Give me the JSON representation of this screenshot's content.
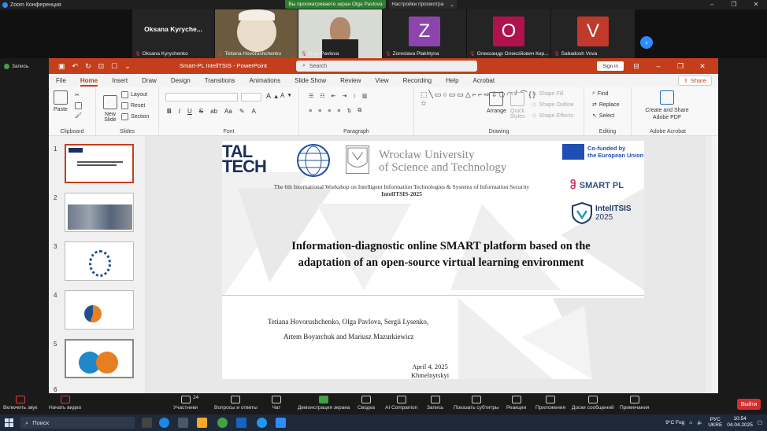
{
  "zoom": {
    "title": "Zoom Конференция",
    "share_notice": "Вы просматриваете экран Olga Pavlova",
    "view_options": "Настройки просмотра",
    "recording_label": "Запись",
    "participants": [
      {
        "name": "Oksana Kyrychenko",
        "big": "Oksana  Kyryche...",
        "type": "text"
      },
      {
        "name": "Tetiana Hovorushchenko",
        "type": "video"
      },
      {
        "name": "Olga Pavlova",
        "type": "video"
      },
      {
        "name": "Zoreslava Plakhtyna",
        "initial": "Z",
        "color": "#8e44ad"
      },
      {
        "name": "Олександр Олексійович Кир...",
        "initial": "O",
        "color": "#b0124e"
      },
      {
        "name": "Sabadosh Vova",
        "initial": "V",
        "color": "#c0392b"
      }
    ],
    "toolbar": [
      {
        "label": "Включить звук"
      },
      {
        "label": "Начать видео"
      },
      {
        "label": "Участники",
        "count": "24"
      },
      {
        "label": "Вопросы и ответы"
      },
      {
        "label": "Чат"
      },
      {
        "label": "Демонстрация экрана"
      },
      {
        "label": "Сводка"
      },
      {
        "label": "AI Companion"
      },
      {
        "label": "Запись"
      },
      {
        "label": "Показать субтитры"
      },
      {
        "label": "Реакции"
      },
      {
        "label": "Приложения"
      },
      {
        "label": "Доски сообщений"
      },
      {
        "label": "Примечания"
      }
    ],
    "exit_label": "Выйти"
  },
  "ppt": {
    "doc_title": "Smart-PL IntellTSIS  -  PowerPoint",
    "search_placeholder": "Search",
    "sign_in": "Sign in",
    "share": "Share",
    "tabs": [
      "File",
      "Home",
      "Insert",
      "Draw",
      "Design",
      "Transitions",
      "Animations",
      "Slide Show",
      "Review",
      "View",
      "Recording",
      "Help",
      "Acrobat"
    ],
    "active_tab": "Home",
    "groups": {
      "clipboard": "Clipboard",
      "slides": "Slides",
      "font": "Font",
      "paragraph": "Paragraph",
      "drawing": "Drawing",
      "editing": "Editing",
      "adobe": "Adobe Acrobat"
    },
    "buttons": {
      "paste": "Paste",
      "new_slide": "New Slide",
      "layout": "Layout",
      "reset": "Reset",
      "section": "Section",
      "arrange": "Arrange",
      "quick_styles": "Quick Styles",
      "shape_fill": "Shape Fill",
      "shape_outline": "Shape Outline",
      "shape_effects": "Shape Effects",
      "find": "Find",
      "replace": "Replace",
      "select": "Select",
      "create_share_pdf": "Create and Share Adobe PDF"
    },
    "thumb_numbers": [
      "1",
      "2",
      "3",
      "4",
      "5",
      "6"
    ],
    "selected_slide": 1
  },
  "slide": {
    "logo_left": "TAL\nTECH",
    "university": "Wrocław University\nof Science and Technology",
    "eu_text": "Co-funded by\nthe European Union",
    "workshop_line1": "The 6th International Workshop on Intelligent Information Technologies & Systems of Information Security",
    "workshop_line2": "IntelITSIS-2025",
    "smart_pl": "SMART PL",
    "intel_logo_line1": "IntelITSIS",
    "intel_logo_line2": "2025",
    "title": "Information-diagnostic online SMART platform based on the adaptation of an open-source virtual learning environment",
    "authors_line1": "Tetiana Hovorushchenko, Olga Pavlova, Sergii Lysenko,",
    "authors_line2": "Artem Boyarchuk and Mariusz Mazurkiewicz",
    "date": "April 4, 2025",
    "city": "Khmelnytskyi"
  },
  "taskbar": {
    "search_placeholder": "Поиск",
    "weather": "9°C  Fog",
    "lang": "РУС\nUKRE",
    "time": "10:54",
    "date": "04.04.2025"
  }
}
